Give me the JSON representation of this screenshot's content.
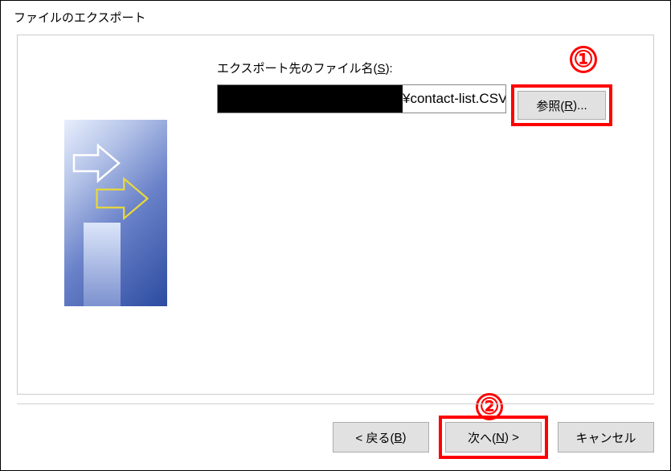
{
  "title": "ファイルのエクスポート",
  "form": {
    "filename_label_pre": "エクスポート先のファイル名(",
    "filename_mnemonic": "S",
    "filename_label_post": "):",
    "filename_visible": "¥contact-list.CSV",
    "browse_pre": "参照(",
    "browse_mnemonic": "R",
    "browse_post": ")..."
  },
  "buttons": {
    "back_pre": "< 戻る(",
    "back_mnemonic": "B",
    "back_post": ")",
    "next_pre": "次へ(",
    "next_mnemonic": "N",
    "next_post": ") >",
    "cancel": "キャンセル"
  },
  "annotations": {
    "one": "①",
    "two": "②"
  }
}
